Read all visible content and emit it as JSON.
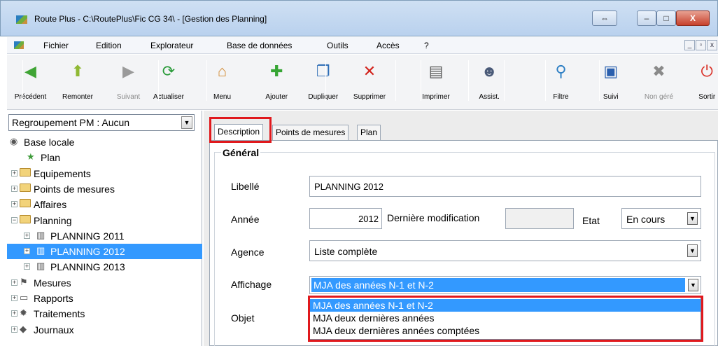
{
  "window": {
    "title": "Route Plus - C:\\RoutePlus\\Fic CG 34\\ - [Gestion des Planning]",
    "buttons": {
      "restore": "⇔",
      "minimize": "–",
      "maximize": "□",
      "close": "X"
    }
  },
  "menubar": {
    "items": [
      "Fichier",
      "Edition",
      "Explorateur",
      "Base de données",
      "Outils",
      "Accès",
      "?"
    ],
    "mdi_buttons": [
      "_",
      "▫",
      "x"
    ]
  },
  "toolbar": {
    "buttons": [
      {
        "label": "Précédent",
        "icon": "arrow-left-icon",
        "glyph": "◀",
        "color": "#3fa435",
        "enabled": true
      },
      {
        "label": "Remonter",
        "icon": "arrow-up-icon",
        "glyph": "⬆",
        "color": "#8fb833",
        "enabled": true
      },
      {
        "label": "Suivant",
        "icon": "arrow-right-icon",
        "glyph": "▶",
        "color": "#9a9a9a",
        "enabled": false
      },
      {
        "label": "Actualiser",
        "icon": "refresh-icon",
        "glyph": "⟳",
        "color": "#2a9b3a",
        "enabled": true
      },
      {
        "label": "Menu",
        "icon": "home-icon",
        "glyph": "⌂",
        "color": "#d1872c",
        "enabled": true
      },
      {
        "label": "Ajouter",
        "icon": "plus-icon",
        "glyph": "✚",
        "color": "#36a534",
        "enabled": true
      },
      {
        "label": "Dupliquer",
        "icon": "duplicate-icon",
        "glyph": "❐",
        "color": "#2b6bb5",
        "enabled": true
      },
      {
        "label": "Supprimer",
        "icon": "delete-icon",
        "glyph": "✕",
        "color": "#d2231c",
        "enabled": true
      },
      {
        "label": "Imprimer",
        "icon": "printer-icon",
        "glyph": "▤",
        "color": "#555555",
        "enabled": true
      },
      {
        "label": "Assist.",
        "icon": "assistant-icon",
        "glyph": "☻",
        "color": "#4a5a78",
        "enabled": true
      },
      {
        "label": "Filtre",
        "icon": "magnifier-icon",
        "glyph": "⚲",
        "color": "#2d7fc4",
        "enabled": true
      },
      {
        "label": "Suivi",
        "icon": "monitor-icon",
        "glyph": "▣",
        "color": "#2a5fae",
        "enabled": true
      },
      {
        "label": "Non géré",
        "icon": "satellite-icon",
        "glyph": "✖",
        "color": "#8a8a8a",
        "enabled": false
      },
      {
        "label": "Sortir",
        "icon": "power-icon",
        "glyph": "⏻",
        "color": "#d92b22",
        "enabled": true
      }
    ]
  },
  "left": {
    "grouping": "Regroupement PM : Aucun",
    "tree": [
      {
        "label": "Base locale",
        "level": 0,
        "icon": "database-icon",
        "exp": ""
      },
      {
        "label": "Plan",
        "level": 1,
        "icon": "map-icon",
        "exp": ""
      },
      {
        "label": "Equipements",
        "level": 0,
        "icon": "folder-icon",
        "exp": "+"
      },
      {
        "label": "Points de mesures",
        "level": 0,
        "icon": "folder-icon",
        "exp": "+"
      },
      {
        "label": "Affaires",
        "level": 0,
        "icon": "folder-icon",
        "exp": "+"
      },
      {
        "label": "Planning",
        "level": 0,
        "icon": "folder-open-icon",
        "exp": "−"
      },
      {
        "label": "PLANNING 2011",
        "level": 1,
        "icon": "bin-icon",
        "exp": "+"
      },
      {
        "label": "PLANNING 2012",
        "level": 1,
        "icon": "bin-icon",
        "exp": "+",
        "selected": true
      },
      {
        "label": "PLANNING 2013",
        "level": 1,
        "icon": "bin-icon",
        "exp": "+"
      },
      {
        "label": "Mesures",
        "level": 0,
        "icon": "measure-icon",
        "exp": "+"
      },
      {
        "label": "Rapports",
        "level": 0,
        "icon": "report-icon",
        "exp": "+"
      },
      {
        "label": "Traitements",
        "level": 0,
        "icon": "gear-icon",
        "exp": "+"
      },
      {
        "label": "Journaux",
        "level": 0,
        "icon": "journal-icon",
        "exp": "+"
      }
    ]
  },
  "tabs": [
    "Description",
    "Points de mesures",
    "Plan"
  ],
  "form": {
    "group_title": "Général",
    "libelle_label": "Libellé",
    "libelle_value": "PLANNING 2012",
    "annee_label": "Année",
    "annee_value": "2012",
    "derniere_modif_label": "Dernière modification",
    "derniere_modif_value": "",
    "etat_label": "Etat",
    "etat_value": "En cours",
    "agence_label": "Agence",
    "agence_value": "Liste complète",
    "affichage_label": "Affichage",
    "affichage_value": "MJA des années N-1 et  N-2",
    "objet_label": "Objet",
    "affichage_options": [
      "MJA des années N-1 et  N-2",
      "MJA deux dernières années",
      "MJA deux dernières années comptées"
    ]
  },
  "colors": {
    "selection": "#3399ff",
    "highlight_box": "#e0191d"
  }
}
